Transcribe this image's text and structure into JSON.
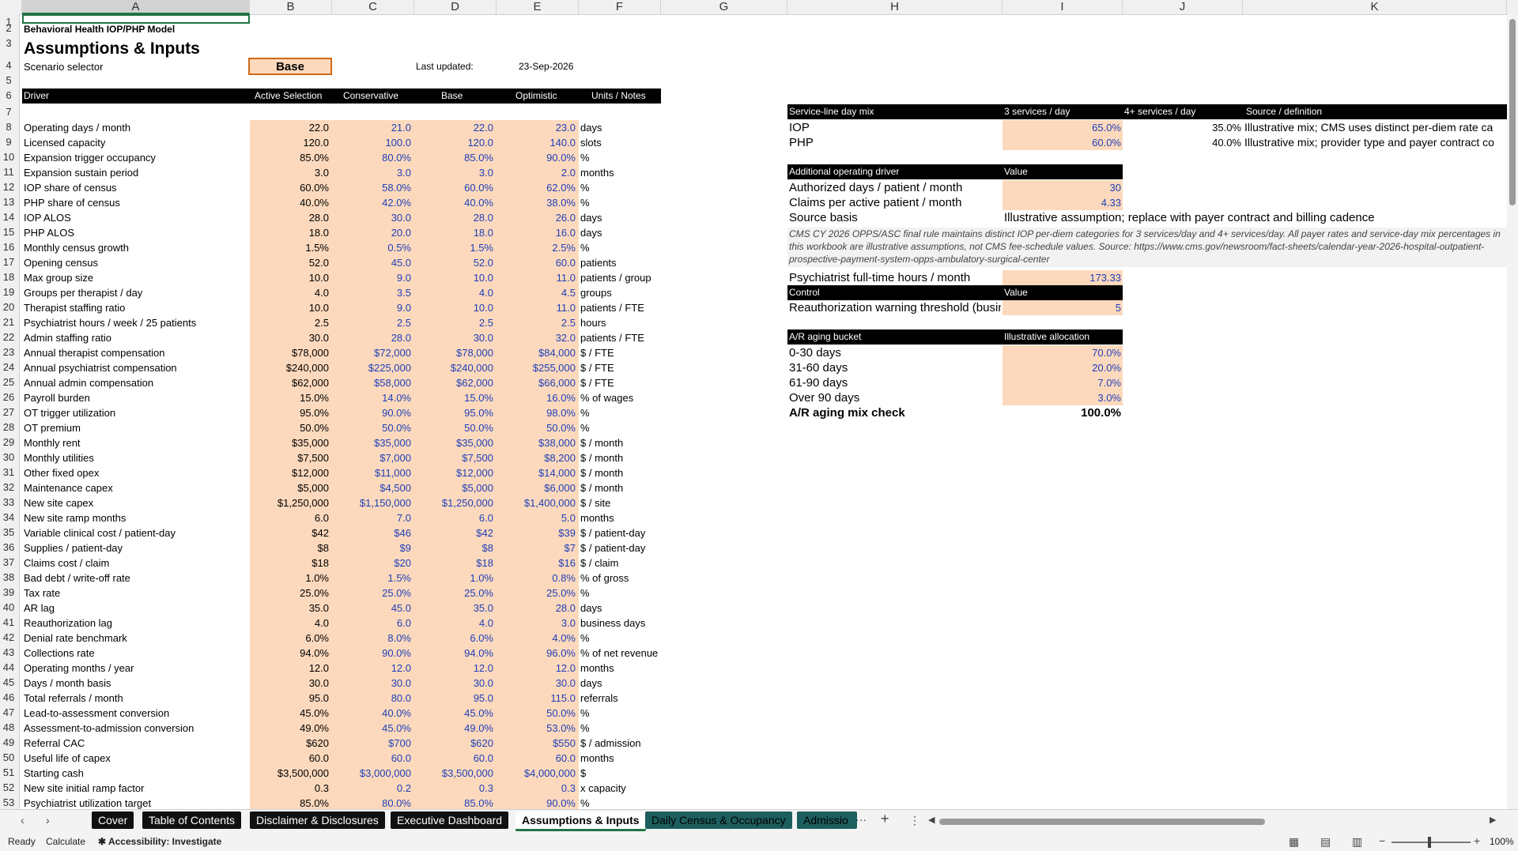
{
  "columns": [
    "A",
    "B",
    "C",
    "D",
    "E",
    "F",
    "G",
    "H",
    "I",
    "J",
    "K"
  ],
  "row_numbers": [
    "1",
    "2",
    "3",
    "4",
    "5",
    "6",
    "7",
    "8",
    "9",
    "10",
    "11",
    "12",
    "13",
    "14",
    "15",
    "16",
    "17",
    "18",
    "19",
    "20",
    "21",
    "22",
    "23",
    "24",
    "25",
    "26",
    "27",
    "28",
    "29",
    "30",
    "31",
    "32",
    "33",
    "34",
    "35",
    "36",
    "37",
    "38",
    "39",
    "40",
    "41",
    "42",
    "43",
    "44",
    "45",
    "46",
    "47",
    "48",
    "49",
    "50",
    "51",
    "52",
    "53"
  ],
  "header": {
    "model_name": "Behavioral Health IOP/PHP Model",
    "title": "Assumptions & Inputs",
    "scenario_label": "Scenario selector",
    "scenario_value": "Base",
    "last_updated_label": "Last updated:",
    "last_updated_value": "23-Sep-2026"
  },
  "table_headers": [
    "Driver",
    "Active Selection",
    "Conservative",
    "Base",
    "Optimistic",
    "Units / Notes"
  ],
  "drivers": [
    {
      "row": "8",
      "name": "Operating days / month",
      "active": "22.0",
      "cons": "21.0",
      "base": "22.0",
      "opt": "23.0",
      "unit": "days"
    },
    {
      "row": "9",
      "name": "Licensed capacity",
      "active": "120.0",
      "cons": "100.0",
      "base": "120.0",
      "opt": "140.0",
      "unit": "slots"
    },
    {
      "row": "10",
      "name": "Expansion trigger occupancy",
      "active": "85.0%",
      "cons": "80.0%",
      "base": "85.0%",
      "opt": "90.0%",
      "unit": "%"
    },
    {
      "row": "11",
      "name": "Expansion sustain period",
      "active": "3.0",
      "cons": "3.0",
      "base": "3.0",
      "opt": "2.0",
      "unit": "months"
    },
    {
      "row": "12",
      "name": "IOP share of census",
      "active": "60.0%",
      "cons": "58.0%",
      "base": "60.0%",
      "opt": "62.0%",
      "unit": "%"
    },
    {
      "row": "13",
      "name": "PHP share of census",
      "active": "40.0%",
      "cons": "42.0%",
      "base": "40.0%",
      "opt": "38.0%",
      "unit": "%"
    },
    {
      "row": "14",
      "name": "IOP ALOS",
      "active": "28.0",
      "cons": "30.0",
      "base": "28.0",
      "opt": "26.0",
      "unit": "days"
    },
    {
      "row": "15",
      "name": "PHP ALOS",
      "active": "18.0",
      "cons": "20.0",
      "base": "18.0",
      "opt": "16.0",
      "unit": "days"
    },
    {
      "row": "16",
      "name": "Monthly census growth",
      "active": "1.5%",
      "cons": "0.5%",
      "base": "1.5%",
      "opt": "2.5%",
      "unit": "%"
    },
    {
      "row": "17",
      "name": "Opening census",
      "active": "52.0",
      "cons": "45.0",
      "base": "52.0",
      "opt": "60.0",
      "unit": "patients"
    },
    {
      "row": "18",
      "name": "Max group size",
      "active": "10.0",
      "cons": "9.0",
      "base": "10.0",
      "opt": "11.0",
      "unit": "patients / group"
    },
    {
      "row": "19",
      "name": "Groups per therapist / day",
      "active": "4.0",
      "cons": "3.5",
      "base": "4.0",
      "opt": "4.5",
      "unit": "groups"
    },
    {
      "row": "20",
      "name": "Therapist staffing ratio",
      "active": "10.0",
      "cons": "9.0",
      "base": "10.0",
      "opt": "11.0",
      "unit": "patients / FTE"
    },
    {
      "row": "21",
      "name": "Psychiatrist hours / week / 25 patients",
      "active": "2.5",
      "cons": "2.5",
      "base": "2.5",
      "opt": "2.5",
      "unit": "hours"
    },
    {
      "row": "22",
      "name": "Admin staffing ratio",
      "active": "30.0",
      "cons": "28.0",
      "base": "30.0",
      "opt": "32.0",
      "unit": "patients / FTE"
    },
    {
      "row": "23",
      "name": "Annual therapist compensation",
      "active": "$78,000",
      "cons": "$72,000",
      "base": "$78,000",
      "opt": "$84,000",
      "unit": "$ / FTE"
    },
    {
      "row": "24",
      "name": "Annual psychiatrist compensation",
      "active": "$240,000",
      "cons": "$225,000",
      "base": "$240,000",
      "opt": "$255,000",
      "unit": "$ / FTE"
    },
    {
      "row": "25",
      "name": "Annual admin compensation",
      "active": "$62,000",
      "cons": "$58,000",
      "base": "$62,000",
      "opt": "$66,000",
      "unit": "$ / FTE"
    },
    {
      "row": "26",
      "name": "Payroll burden",
      "active": "15.0%",
      "cons": "14.0%",
      "base": "15.0%",
      "opt": "16.0%",
      "unit": "% of wages"
    },
    {
      "row": "27",
      "name": "OT trigger utilization",
      "active": "95.0%",
      "cons": "90.0%",
      "base": "95.0%",
      "opt": "98.0%",
      "unit": "%"
    },
    {
      "row": "28",
      "name": "OT premium",
      "active": "50.0%",
      "cons": "50.0%",
      "base": "50.0%",
      "opt": "50.0%",
      "unit": "%"
    },
    {
      "row": "29",
      "name": "Monthly rent",
      "active": "$35,000",
      "cons": "$35,000",
      "base": "$35,000",
      "opt": "$38,000",
      "unit": "$ / month"
    },
    {
      "row": "30",
      "name": "Monthly utilities",
      "active": "$7,500",
      "cons": "$7,000",
      "base": "$7,500",
      "opt": "$8,200",
      "unit": "$ / month"
    },
    {
      "row": "31",
      "name": "Other fixed opex",
      "active": "$12,000",
      "cons": "$11,000",
      "base": "$12,000",
      "opt": "$14,000",
      "unit": "$ / month"
    },
    {
      "row": "32",
      "name": "Maintenance capex",
      "active": "$5,000",
      "cons": "$4,500",
      "base": "$5,000",
      "opt": "$6,000",
      "unit": "$ / month"
    },
    {
      "row": "33",
      "name": "New site capex",
      "active": "$1,250,000",
      "cons": "$1,150,000",
      "base": "$1,250,000",
      "opt": "$1,400,000",
      "unit": "$ / site"
    },
    {
      "row": "34",
      "name": "New site ramp months",
      "active": "6.0",
      "cons": "7.0",
      "base": "6.0",
      "opt": "5.0",
      "unit": "months"
    },
    {
      "row": "35",
      "name": "Variable clinical cost / patient-day",
      "active": "$42",
      "cons": "$46",
      "base": "$42",
      "opt": "$39",
      "unit": "$ / patient-day"
    },
    {
      "row": "36",
      "name": "Supplies / patient-day",
      "active": "$8",
      "cons": "$9",
      "base": "$8",
      "opt": "$7",
      "unit": "$ / patient-day"
    },
    {
      "row": "37",
      "name": "Claims cost / claim",
      "active": "$18",
      "cons": "$20",
      "base": "$18",
      "opt": "$16",
      "unit": "$ / claim"
    },
    {
      "row": "38",
      "name": "Bad debt / write-off rate",
      "active": "1.0%",
      "cons": "1.5%",
      "base": "1.0%",
      "opt": "0.8%",
      "unit": "% of gross"
    },
    {
      "row": "39",
      "name": "Tax rate",
      "active": "25.0%",
      "cons": "25.0%",
      "base": "25.0%",
      "opt": "25.0%",
      "unit": "%"
    },
    {
      "row": "40",
      "name": "AR lag",
      "active": "35.0",
      "cons": "45.0",
      "base": "35.0",
      "opt": "28.0",
      "unit": "days"
    },
    {
      "row": "41",
      "name": "Reauthorization lag",
      "active": "4.0",
      "cons": "6.0",
      "base": "4.0",
      "opt": "3.0",
      "unit": "business days"
    },
    {
      "row": "42",
      "name": "Denial rate benchmark",
      "active": "6.0%",
      "cons": "8.0%",
      "base": "6.0%",
      "opt": "4.0%",
      "unit": "%"
    },
    {
      "row": "43",
      "name": "Collections rate",
      "active": "94.0%",
      "cons": "90.0%",
      "base": "94.0%",
      "opt": "96.0%",
      "unit": "% of net revenue"
    },
    {
      "row": "44",
      "name": "Operating months / year",
      "active": "12.0",
      "cons": "12.0",
      "base": "12.0",
      "opt": "12.0",
      "unit": "months"
    },
    {
      "row": "45",
      "name": "Days / month basis",
      "active": "30.0",
      "cons": "30.0",
      "base": "30.0",
      "opt": "30.0",
      "unit": "days"
    },
    {
      "row": "46",
      "name": "Total referrals / month",
      "active": "95.0",
      "cons": "80.0",
      "base": "95.0",
      "opt": "115.0",
      "unit": "referrals"
    },
    {
      "row": "47",
      "name": "Lead-to-assessment conversion",
      "active": "45.0%",
      "cons": "40.0%",
      "base": "45.0%",
      "opt": "50.0%",
      "unit": "%"
    },
    {
      "row": "48",
      "name": "Assessment-to-admission conversion",
      "active": "49.0%",
      "cons": "45.0%",
      "base": "49.0%",
      "opt": "53.0%",
      "unit": "%"
    },
    {
      "row": "49",
      "name": "Referral CAC",
      "active": "$620",
      "cons": "$700",
      "base": "$620",
      "opt": "$550",
      "unit": "$ / admission"
    },
    {
      "row": "50",
      "name": "Useful life of capex",
      "active": "60.0",
      "cons": "60.0",
      "base": "60.0",
      "opt": "60.0",
      "unit": "months"
    },
    {
      "row": "51",
      "name": "Starting cash",
      "active": "$3,500,000",
      "cons": "$3,000,000",
      "base": "$3,500,000",
      "opt": "$4,000,000",
      "unit": "$"
    },
    {
      "row": "52",
      "name": "New site initial ramp factor",
      "active": "0.3",
      "cons": "0.2",
      "base": "0.3",
      "opt": "0.3",
      "unit": "x capacity"
    },
    {
      "row": "53",
      "name": "Psychiatrist utilization target",
      "active": "85.0%",
      "cons": "80.0%",
      "base": "85.0%",
      "opt": "90.0%",
      "unit": "%"
    }
  ],
  "service_mix": {
    "headers": [
      "Service-line day mix",
      "3 services / day",
      "4+ services / day",
      "Source / definition"
    ],
    "rows": [
      {
        "name": "IOP",
        "three": "65.0%",
        "four": "35.0%",
        "source": "Illustrative mix; CMS uses distinct per-diem rate ca"
      },
      {
        "name": "PHP",
        "three": "60.0%",
        "four": "40.0%",
        "source": "Illustrative mix; provider type and payer contract co"
      }
    ]
  },
  "additional_driver": {
    "headers": [
      "Additional operating driver",
      "Value"
    ],
    "rows": [
      {
        "name": "Authorized days / patient / month",
        "value": "30"
      },
      {
        "name": "Claims per active patient / month",
        "value": "4.33"
      }
    ],
    "source_label": "Source basis",
    "source_value": "Illustrative assumption; replace with payer contract and billing cadence",
    "note": "CMS CY 2026 OPPS/ASC final rule maintains distinct IOP per-diem categories for 3 services/day and 4+ services/day. All payer rates and service-day mix percentages in this workbook are illustrative assumptions, not CMS fee-schedule values. Source: https://www.cms.gov/newsroom/fact-sheets/calendar-year-2026-hospital-outpatient-prospective-payment-system-opps-ambulatory-surgical-center",
    "psych_label": "Psychiatrist full-time hours / month",
    "psych_value": "173.33"
  },
  "control": {
    "headers": [
      "Control",
      "Value"
    ],
    "name": "Reauthorization warning threshold (busine",
    "value": "5"
  },
  "ar_aging": {
    "headers": [
      "A/R aging bucket",
      "Illustrative allocation"
    ],
    "rows": [
      {
        "name": "0-30 days",
        "value": "70.0%"
      },
      {
        "name": "31-60 days",
        "value": "20.0%"
      },
      {
        "name": "61-90 days",
        "value": "7.0%"
      },
      {
        "name": "Over 90 days",
        "value": "3.0%"
      }
    ],
    "check_label": "A/R aging mix check",
    "check_value": "100.0%"
  },
  "tabs": [
    "Cover",
    "Table of Contents",
    "Disclaimer & Disclosures",
    "Executive Dashboard",
    "Assumptions & Inputs",
    "Daily Census & Occupancy",
    "Admissio"
  ],
  "status": {
    "ready": "Ready",
    "calculate": "Calculate",
    "accessibility": "Accessibility: Investigate",
    "zoom": "100%"
  },
  "colors": {
    "input_fill": "#fcd9bd",
    "input_text": "#1f3fb8",
    "header_fill": "#000000",
    "accent": "#217346"
  }
}
